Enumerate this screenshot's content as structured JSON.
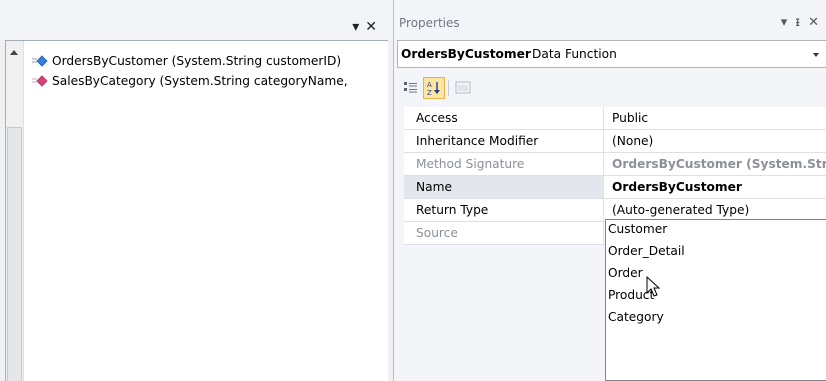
{
  "left_pane": {
    "header_buttons": [
      "dropdown-arrow",
      "close"
    ],
    "functions": [
      {
        "label": "OrdersByCustomer (System.String customerID)",
        "icon": "method-icon-blue"
      },
      {
        "label": "SalesByCategory (System.String categoryName,",
        "icon": "method-icon-pink"
      }
    ]
  },
  "properties": {
    "title": "Properties",
    "object_name": "OrdersByCustomer",
    "object_type": "Data Function",
    "toolbar": [
      "categorized-icon",
      "alphabetical-icon",
      "property-pages-icon"
    ],
    "rows": [
      {
        "name": "Access",
        "value": "Public"
      },
      {
        "name": "Inheritance Modifier",
        "value": "(None)"
      },
      {
        "name": "Method Signature",
        "value": "OrdersByCustomer (System.String customerID)"
      },
      {
        "name": "Name",
        "value": "OrdersByCustomer"
      },
      {
        "name": "Return Type",
        "value": "(Auto-generated Type)"
      },
      {
        "name": "Source",
        "value": ""
      }
    ],
    "dropdown_options": [
      "Customer",
      "Order_Detail",
      "Order",
      "Product",
      "Category"
    ]
  },
  "colors": {
    "accent_blue": "#3a7fd5",
    "accent_pink": "#d9437a",
    "toolbar_active": "#fde6a3"
  }
}
